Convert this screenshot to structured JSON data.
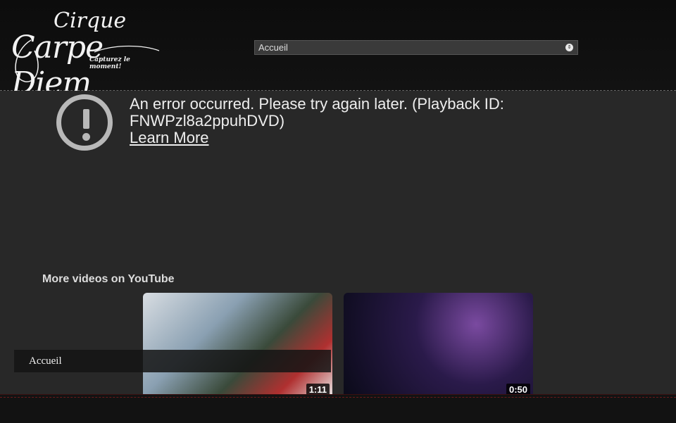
{
  "logo": {
    "line1": "Cirque",
    "line2": "Carpe Diem",
    "tagline": "Capturez le moment!"
  },
  "nav": {
    "selected": "Accueil"
  },
  "player": {
    "error_message": "An error occurred. Please try again later. (Playback ID: FNWPzl8a2ppuhDVD)",
    "learn_more": "Learn More",
    "more_videos_label": "More videos on YouTube",
    "videos": [
      {
        "duration": "1:11"
      },
      {
        "duration": "0:50"
      }
    ]
  },
  "menu": {
    "label": "Accueil"
  },
  "colors": {
    "accent": "#6a1a1a",
    "background": "#2b2b2b",
    "header": "#0c0c0c"
  }
}
